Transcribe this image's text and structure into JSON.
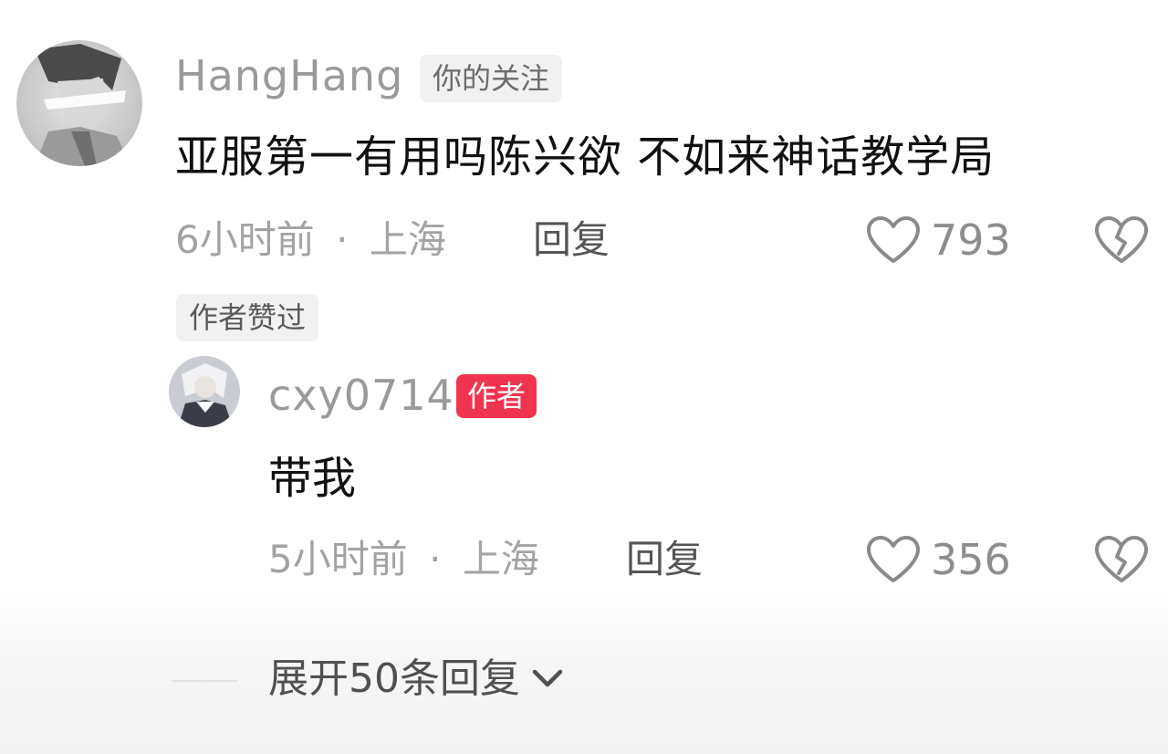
{
  "comment": {
    "username": "HangHang",
    "follow_badge": "你的关注",
    "text": "亚服第一有用吗陈兴欲 不如来神话教学局",
    "time": "6小时前",
    "separator": "·",
    "location": "上海",
    "reply_label": "回复",
    "like_count": "793",
    "author_liked_label": "作者赞过"
  },
  "reply": {
    "username": "cxy0714",
    "author_badge": "作者",
    "text": "带我",
    "time": "5小时前",
    "separator": "·",
    "location": "上海",
    "reply_label": "回复",
    "like_count": "356"
  },
  "expand": {
    "label": "展开50条回复"
  },
  "icons": {
    "like": "heart-outline-icon",
    "dislike": "broken-heart-icon",
    "expand": "chevron-down-icon"
  },
  "colors": {
    "author_badge_bg": "#f0344f",
    "text_primary": "#111111",
    "text_muted": "#a3a3a3"
  }
}
